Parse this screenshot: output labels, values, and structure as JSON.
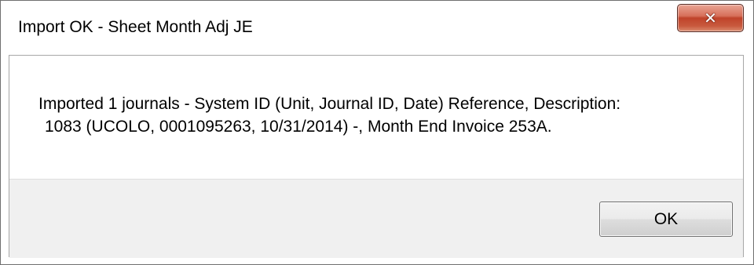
{
  "dialog": {
    "title": "Import OK - Sheet Month Adj JE",
    "close_icon": "close-icon",
    "message_line1": "Imported  1 journals - System ID (Unit, Journal ID, Date) Reference, Description:",
    "message_line2": "1083 (UCOLO, 0001095263, 10/31/2014) -, Month End Invoice 253A.",
    "ok_label": "OK"
  }
}
